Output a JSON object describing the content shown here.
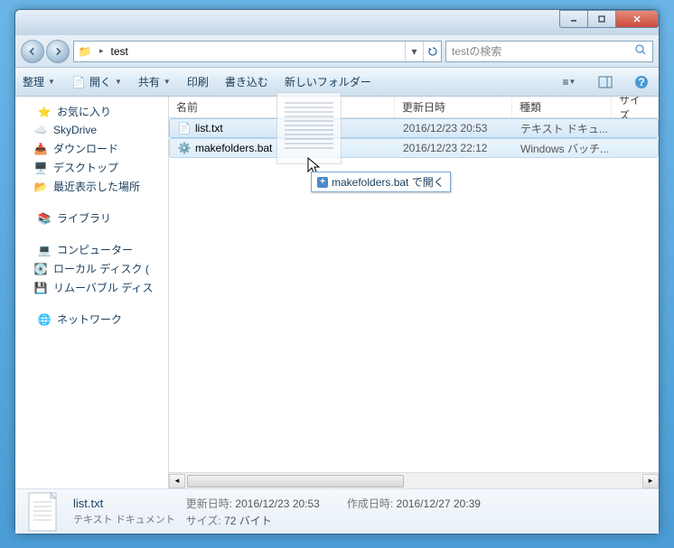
{
  "window": {
    "path_folder": "test",
    "search_placeholder": "testの検索"
  },
  "toolbar": {
    "organize": "整理",
    "open": "開く",
    "share": "共有",
    "print": "印刷",
    "burn": "書き込む",
    "newfolder": "新しいフォルダー"
  },
  "sidebar": {
    "favorites": "お気に入り",
    "skydrive": "SkyDrive",
    "downloads": "ダウンロード",
    "desktop": "デスクトップ",
    "recent": "最近表示した場所",
    "libraries": "ライブラリ",
    "computer": "コンピューター",
    "localdisk": "ローカル ディスク (",
    "removable": "リムーバブル ディス",
    "network": "ネットワーク"
  },
  "columns": {
    "name": "名前",
    "date": "更新日時",
    "type": "種類",
    "size": "サイズ"
  },
  "files": [
    {
      "name": "list.txt",
      "date": "2016/12/23 20:53",
      "type": "テキスト ドキュ..."
    },
    {
      "name": "makefolders.bat",
      "date": "2016/12/23 22:12",
      "type": "Windows バッチ..."
    }
  ],
  "tooltip": "makefolders.bat で開く",
  "details": {
    "name": "list.txt",
    "type": "テキスト ドキュメント",
    "modlabel": "更新日時:",
    "modval": "2016/12/23 20:53",
    "createlabel": "作成日時:",
    "createval": "2016/12/27 20:39",
    "sizelabel": "サイズ:",
    "sizeval": "72 バイト"
  }
}
